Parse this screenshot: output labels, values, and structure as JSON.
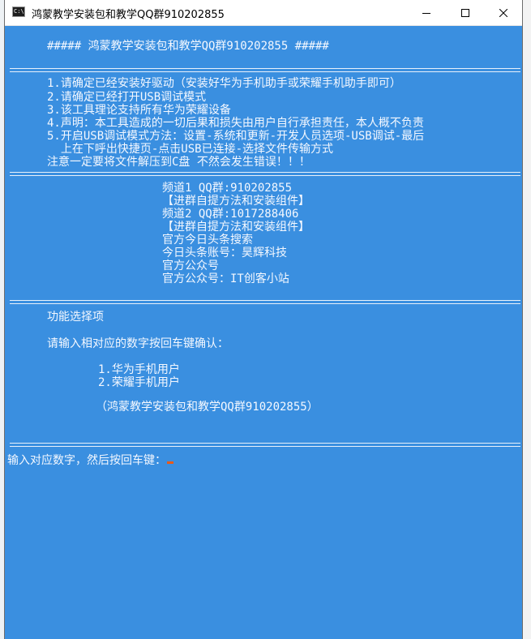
{
  "window": {
    "title": "鸿蒙教学安装包和教学QQ群910202855"
  },
  "console": {
    "header": "##### 鸿蒙教学安装包和教学QQ群910202855 #####",
    "notes": [
      "1.请确定已经安装好驱动（安装好华为手机助手或荣耀手机助手即可）",
      "2.请确定已经打开USB调试模式",
      "3.该工具理论支持所有华为荣耀设备",
      "4.声明：本工具造成的一切后果和损失由用户自行承担责任，本人概不负责",
      "5.开启USB调试模式方法：设置-系统和更新-开发人员选项-USB调试-最后",
      "  上在下呼出快捷页-点击USB已连接-选择文件传输方式",
      "注意一定要将文件解压到C盘 不然会发生错误！！！"
    ],
    "channels": [
      "频道1 QQ群:910202855",
      "【进群自提方法和安装组件】",
      "频道2 QQ群:1017288406",
      "【进群自提方法和安装组件】",
      "官方今日头条搜索",
      "今日头条账号：昊辉科技",
      "官方公众号",
      "官方公众号：IT创客小站"
    ],
    "menu_title": "功能选择项",
    "menu_prompt": "请输入相对应的数字按回车键确认：",
    "options": [
      "1.华为手机用户",
      "2.荣耀手机用户"
    ],
    "footer_note": "（鸿蒙教学安装包和教学QQ群910202855）",
    "input_prompt": "输入对应数字，然后按回车键："
  },
  "colors": {
    "console_bg": "#3a8fe0",
    "text": "#f4f8ff",
    "cursor": "#e85a1a"
  }
}
